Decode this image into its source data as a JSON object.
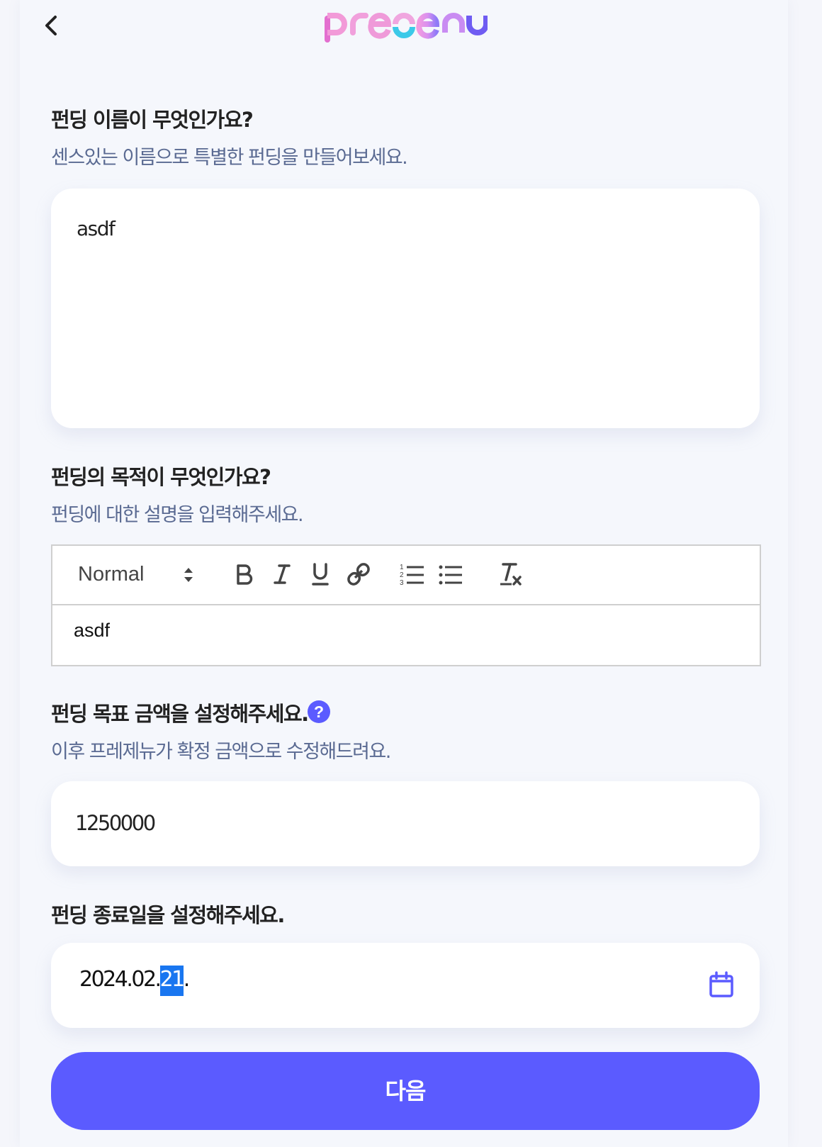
{
  "header": {
    "logo_text": "presenu",
    "back_icon": "chevron-left-icon"
  },
  "name_section": {
    "title": "펀딩 이름이 무엇인가요?",
    "subtitle": "센스있는 이름으로 특별한 펀딩을 만들어보세요.",
    "value": "asdf"
  },
  "purpose_section": {
    "title": "펀딩의 목적이 무엇인가요?",
    "subtitle": "펀딩에 대한 설명을 입력해주세요.",
    "editor": {
      "format_select": "Normal",
      "toolbar_icons": [
        "bold-icon",
        "italic-icon",
        "underline-icon",
        "link-icon",
        "ordered-list-icon",
        "bullet-list-icon",
        "clear-format-icon"
      ],
      "content": "asdf"
    }
  },
  "amount_section": {
    "title": "펀딩 목표 금액을 설정해주세요.",
    "help_glyph": "?",
    "subtitle": "이후 프레제뉴가 확정 금액으로 수정해드려요.",
    "value": "1250000"
  },
  "date_section": {
    "title": "펀딩 종료일을 설정해주세요.",
    "date_prefix": "2024.02.",
    "date_selected": "21",
    "date_suffix": ".",
    "calendar_icon": "calendar-icon"
  },
  "next_button": {
    "label": "다음"
  },
  "colors": {
    "accent": "#5b5bff",
    "logo_pink": "#f48ad8",
    "logo_cyan": "#3cc9e8",
    "logo_purple": "#6f5cf2",
    "subtitle": "#5a6a92",
    "date_highlight": "#1976f0"
  }
}
